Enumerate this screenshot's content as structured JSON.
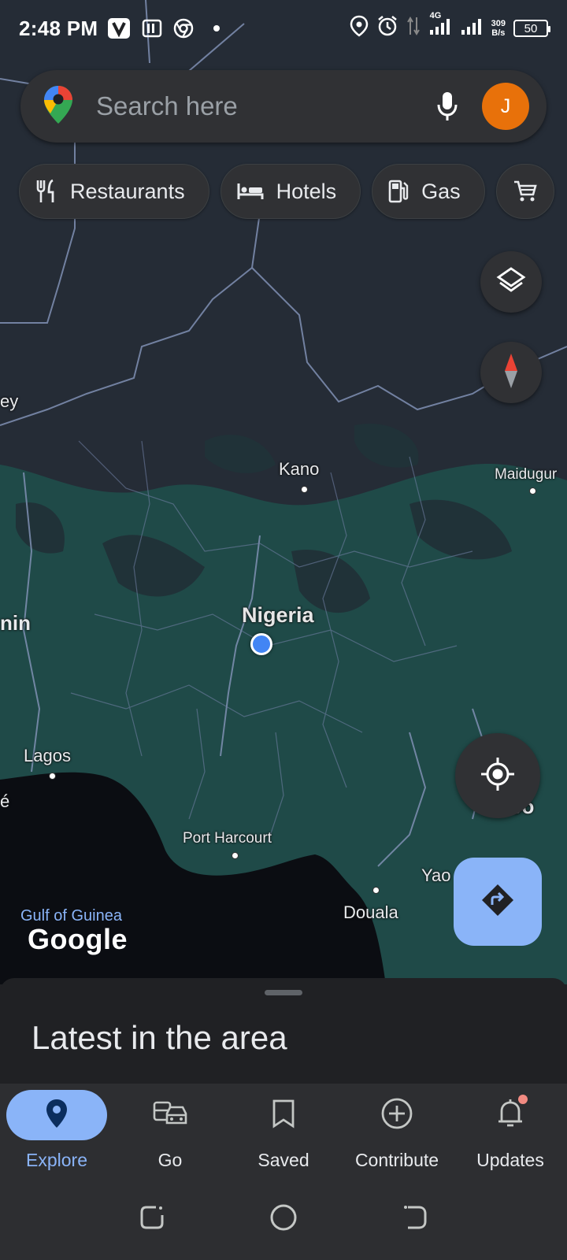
{
  "status_bar": {
    "time": "2:48 PM",
    "network": "4G",
    "net_speed_value": "309",
    "net_speed_unit": "B/s",
    "battery": "50",
    "left_icons": [
      "v-app-icon",
      "pocket-icon",
      "chrome-icon",
      "dot-icon"
    ],
    "right_icons": [
      "location-icon",
      "alarm-icon",
      "data-arrows-icon",
      "signal-icon",
      "signal-icon"
    ]
  },
  "search": {
    "placeholder": "Search here",
    "avatar_initial": "J"
  },
  "chips": [
    {
      "label": "Restaurants",
      "icon": "restaurant-icon"
    },
    {
      "label": "Hotels",
      "icon": "hotel-icon"
    },
    {
      "label": "Gas",
      "icon": "gas-station-icon"
    },
    {
      "label": "",
      "icon": "shopping-cart-icon"
    }
  ],
  "map": {
    "country_label": "Nigeria",
    "cities": {
      "kano": "Kano",
      "maiduguri": "Maidugur",
      "lagos": "Lagos",
      "port_harcourt": "Port Harcourt",
      "douala": "Douala",
      "yaounde": "Yao",
      "cameroon": "eroo"
    },
    "edge_labels": {
      "niger_fragment": "ey",
      "benin_fragment": "nin",
      "togo_fragment": "é"
    },
    "water_label": "Gulf of Guinea",
    "logo": "Google",
    "colors": {
      "land": "#252c36",
      "vegetation": "#1e4a48",
      "water": "#0b0d12",
      "borders": "#7f8fb0",
      "accent": "#8ab4f8"
    }
  },
  "sheet": {
    "title": "Latest in the area"
  },
  "nav": {
    "items": [
      {
        "label": "Explore",
        "icon": "explore-pin-icon",
        "active": true
      },
      {
        "label": "Go",
        "icon": "commute-icon",
        "active": false
      },
      {
        "label": "Saved",
        "icon": "bookmark-icon",
        "active": false
      },
      {
        "label": "Contribute",
        "icon": "add-circle-icon",
        "active": false
      },
      {
        "label": "Updates",
        "icon": "bell-icon",
        "active": false
      }
    ]
  }
}
